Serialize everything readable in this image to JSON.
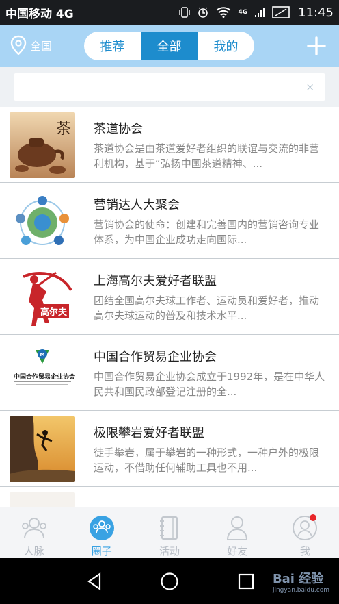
{
  "status_bar": {
    "carrier": "中国移动 4G",
    "network_badge": "4G",
    "time": "11:45"
  },
  "header": {
    "region": "全国",
    "tabs": [
      {
        "label": "推荐",
        "active": false
      },
      {
        "label": "全部",
        "active": true
      },
      {
        "label": "我的",
        "active": false
      }
    ]
  },
  "search": {
    "value": "",
    "placeholder": "",
    "clear_icon": "×"
  },
  "groups": [
    {
      "title": "茶道协会",
      "desc": "茶道协会是由茶道爱好者组织的联谊与交流的非营利机构，基于“弘扬中国茶道精神、...",
      "thumb_text": "茶"
    },
    {
      "title": "营销达人大聚会",
      "desc": "营销协会的使命：创建和完善国内的营销咨询专业体系，为中国企业成功走向国际...",
      "thumb_text": ""
    },
    {
      "title": "上海高尔夫爱好者联盟",
      "desc": "团结全国高尔夫球工作者、运动员和爱好者，推动高尔夫球运动的普及和技术水平...",
      "thumb_text": "高尔夫"
    },
    {
      "title": "中国合作贸易企业协会",
      "desc": "中国合作贸易企业协会成立于1992年，是在中华人民共和国民政部登记注册的全...",
      "thumb_text": "中国合作贸易企业协会"
    },
    {
      "title": "极限攀岩爱好者联盟",
      "desc": "徒手攀岩，属于攀岩的一种形式，一种户外的极限运动，不借助任何辅助工具也不用...",
      "thumb_text": ""
    }
  ],
  "tab_bar": [
    {
      "label": "人脉",
      "icon": "contacts-icon",
      "active": false
    },
    {
      "label": "圈子",
      "icon": "circle-group-icon",
      "active": true
    },
    {
      "label": "活动",
      "icon": "notebook-icon",
      "active": false
    },
    {
      "label": "好友",
      "icon": "friend-icon",
      "active": false
    },
    {
      "label": "我",
      "icon": "profile-icon",
      "active": false
    }
  ],
  "watermark": {
    "main": "Bai 经验",
    "sub": "jingyan.baidu.com"
  },
  "colors": {
    "header_bg": "#a9d5f5",
    "accent": "#1d8ccd",
    "tab_active": "#39a2e3",
    "badge": "#e8262a"
  }
}
